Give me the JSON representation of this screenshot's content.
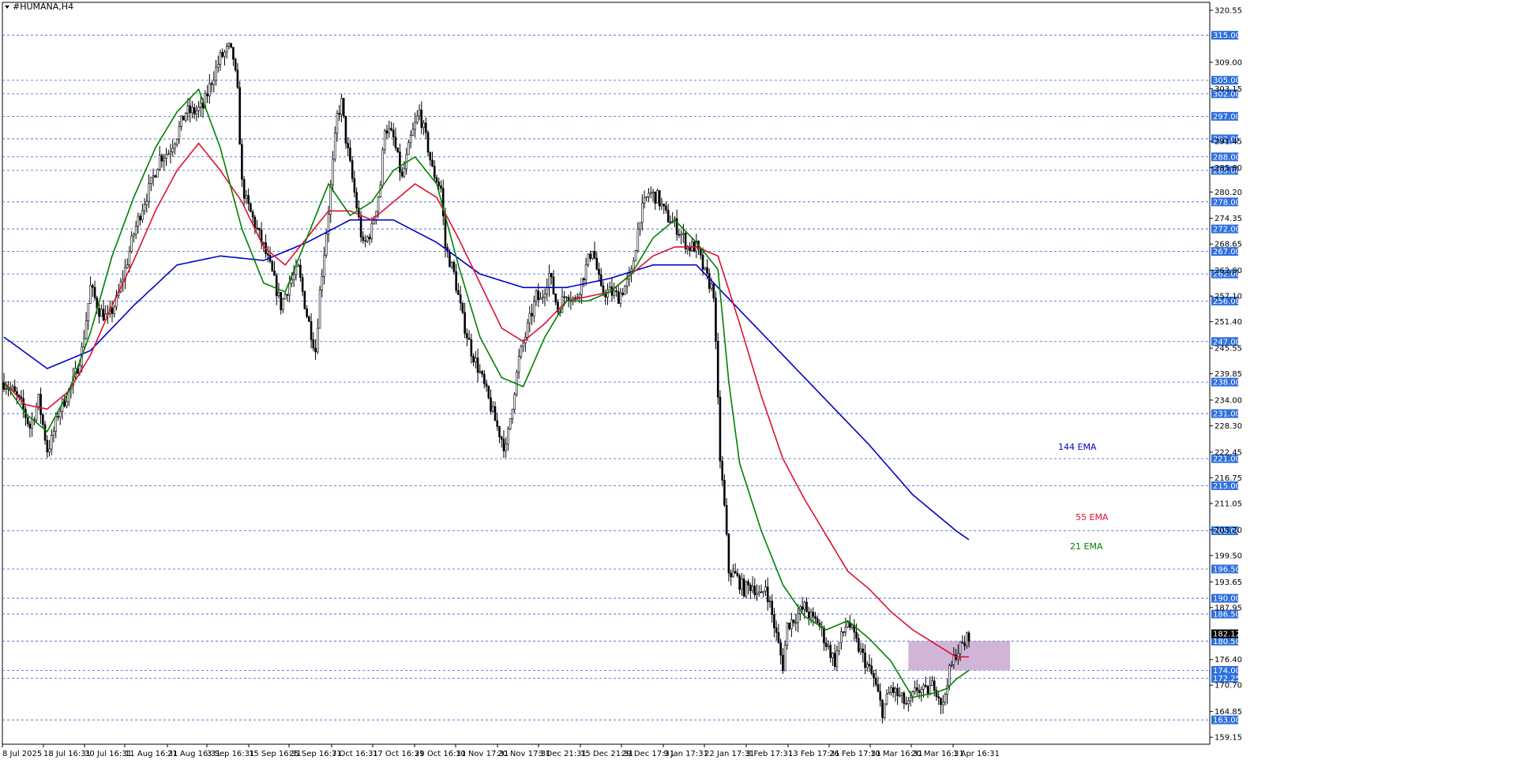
{
  "window": {
    "title": "#HUMANA,H4",
    "menu_icon": "triangle-down-icon"
  },
  "colors": {
    "level_line": "#3a5fcd",
    "level_label_bg": "#2f6fde",
    "ema21": "#008000",
    "ema55": "#e0102f",
    "ema144": "#0000cc",
    "zone_fill": "#c8a8d0",
    "current_price_bg": "#000000",
    "candle": "#000000"
  },
  "chart_data": {
    "type": "candlestick",
    "symbol": "#HUMANA",
    "timeframe": "H4",
    "x_tick_labels": [
      "8 Jul 2025",
      "18 Jul 16:31",
      "30 Jul 16:31",
      "11 Aug 16:31",
      "21 Aug 16:31",
      "3 Sep 16:31",
      "15 Sep 16:31",
      "25 Sep 16:31",
      "7 Oct 16:31",
      "17 Oct 16:31",
      "29 Oct 16:31",
      "10 Nov 17:31",
      "20 Nov 17:31",
      "3 Dec 21:31",
      "15 Dec 21:31",
      "29 Dec 17:31",
      "9 Jan 17:31",
      "22 Jan 17:31",
      "3 Feb 17:31",
      "13 Feb 17:31",
      "26 Feb 17:31",
      "10 Mar 16:31",
      "20 Mar 16:31",
      "1 Apr 16:31"
    ],
    "y_tick_labels": [
      "320.55",
      "309.00",
      "303.15",
      "291.45",
      "285.60",
      "280.20",
      "274.35",
      "268.65",
      "262.80",
      "257.10",
      "251.40",
      "245.55",
      "239.85",
      "234.00",
      "228.30",
      "222.45",
      "216.75",
      "211.05",
      "205.20",
      "199.50",
      "193.65",
      "187.95",
      "176.40",
      "170.70",
      "164.85",
      "159.15"
    ],
    "ylim": [
      157.6,
      322.3
    ],
    "levels": [
      "315.00",
      "305.00",
      "302.00",
      "297.00",
      "292.00",
      "288.00",
      "285.00",
      "278.00",
      "272.00",
      "267.00",
      "262.00",
      "256.00",
      "247.00",
      "238.00",
      "231.00",
      "221.00",
      "215.00",
      "205.00",
      "196.50",
      "190.00",
      "186.50",
      "180.50",
      "174.00",
      "172.25",
      "163.00"
    ],
    "current_price": "182.12",
    "zone": {
      "low": 174.0,
      "high": 180.5
    },
    "close_path": [
      [
        0,
        238
      ],
      [
        4,
        236
      ],
      [
        8,
        233
      ],
      [
        12,
        228
      ],
      [
        16,
        234
      ],
      [
        20,
        223
      ],
      [
        22,
        225
      ],
      [
        25,
        231
      ],
      [
        28,
        234
      ],
      [
        32,
        238
      ],
      [
        36,
        245
      ],
      [
        40,
        259
      ],
      [
        44,
        254
      ],
      [
        48,
        252
      ],
      [
        52,
        256
      ],
      [
        56,
        263
      ],
      [
        60,
        271
      ],
      [
        64,
        277
      ],
      [
        68,
        282
      ],
      [
        72,
        288
      ],
      [
        76,
        289
      ],
      [
        80,
        293
      ],
      [
        84,
        298
      ],
      [
        88,
        298
      ],
      [
        92,
        299
      ],
      [
        96,
        305
      ],
      [
        100,
        310
      ],
      [
        104,
        312
      ],
      [
        106,
        310
      ],
      [
        108,
        302
      ],
      [
        110,
        282
      ],
      [
        112,
        278
      ],
      [
        116,
        273
      ],
      [
        120,
        268
      ],
      [
        124,
        262
      ],
      [
        128,
        255
      ],
      [
        132,
        260
      ],
      [
        136,
        263
      ],
      [
        140,
        253
      ],
      [
        144,
        245
      ],
      [
        146,
        258
      ],
      [
        150,
        276
      ],
      [
        154,
        297
      ],
      [
        156,
        300
      ],
      [
        158,
        292
      ],
      [
        162,
        280
      ],
      [
        166,
        268
      ],
      [
        170,
        272
      ],
      [
        174,
        282
      ],
      [
        176,
        295
      ],
      [
        180,
        292
      ],
      [
        184,
        283
      ],
      [
        188,
        292
      ],
      [
        192,
        298
      ],
      [
        196,
        290
      ],
      [
        198,
        285
      ],
      [
        202,
        281
      ],
      [
        204,
        268
      ],
      [
        208,
        262
      ],
      [
        212,
        252
      ],
      [
        216,
        245
      ],
      [
        220,
        240
      ],
      [
        224,
        234
      ],
      [
        228,
        228
      ],
      [
        232,
        223
      ],
      [
        234,
        230
      ],
      [
        238,
        243
      ],
      [
        242,
        250
      ],
      [
        246,
        257
      ],
      [
        248,
        256
      ],
      [
        252,
        262
      ],
      [
        256,
        254
      ],
      [
        260,
        258
      ],
      [
        264,
        256
      ],
      [
        268,
        262
      ],
      [
        272,
        268
      ],
      [
        276,
        258
      ],
      [
        280,
        258
      ],
      [
        284,
        257
      ],
      [
        288,
        260
      ],
      [
        290,
        262
      ],
      [
        294,
        275
      ],
      [
        298,
        280
      ],
      [
        302,
        279
      ],
      [
        306,
        275
      ],
      [
        310,
        273
      ],
      [
        314,
        270
      ],
      [
        316,
        268
      ],
      [
        320,
        268
      ],
      [
        324,
        262
      ],
      [
        328,
        258
      ],
      [
        331,
        221
      ],
      [
        333,
        210
      ],
      [
        335,
        196
      ],
      [
        338,
        195
      ],
      [
        342,
        192
      ],
      [
        346,
        193
      ],
      [
        350,
        190
      ],
      [
        352,
        193
      ],
      [
        356,
        184
      ],
      [
        360,
        175
      ],
      [
        362,
        184
      ],
      [
        366,
        186
      ],
      [
        370,
        188
      ],
      [
        374,
        185
      ],
      [
        376,
        185
      ],
      [
        380,
        180
      ],
      [
        384,
        176
      ],
      [
        386,
        180
      ],
      [
        390,
        185
      ],
      [
        394,
        180
      ],
      [
        398,
        176
      ],
      [
        402,
        172
      ],
      [
        406,
        165
      ],
      [
        410,
        170
      ],
      [
        414,
        168
      ],
      [
        418,
        166
      ],
      [
        422,
        170
      ],
      [
        426,
        169
      ],
      [
        430,
        171
      ],
      [
        434,
        166
      ],
      [
        436,
        172
      ],
      [
        440,
        178
      ],
      [
        444,
        180
      ],
      [
        446,
        182
      ]
    ],
    "series": [
      {
        "name": "144 EMA",
        "color": "#0000cc",
        "values": [
          [
            0,
            248
          ],
          [
            20,
            241
          ],
          [
            40,
            245
          ],
          [
            60,
            255
          ],
          [
            80,
            264
          ],
          [
            100,
            266
          ],
          [
            120,
            265
          ],
          [
            140,
            269
          ],
          [
            160,
            274
          ],
          [
            180,
            274
          ],
          [
            200,
            269
          ],
          [
            220,
            262
          ],
          [
            240,
            259
          ],
          [
            260,
            259
          ],
          [
            280,
            261
          ],
          [
            300,
            264
          ],
          [
            320,
            264
          ],
          [
            340,
            254
          ],
          [
            360,
            244
          ],
          [
            380,
            234
          ],
          [
            400,
            224
          ],
          [
            420,
            213
          ],
          [
            440,
            205
          ],
          [
            446,
            203
          ]
        ]
      },
      {
        "name": "55 EMA",
        "color": "#e0102f",
        "values": [
          [
            0,
            238
          ],
          [
            10,
            233
          ],
          [
            20,
            232
          ],
          [
            30,
            236
          ],
          [
            40,
            244
          ],
          [
            50,
            255
          ],
          [
            60,
            265
          ],
          [
            70,
            276
          ],
          [
            80,
            285
          ],
          [
            90,
            291
          ],
          [
            100,
            285
          ],
          [
            110,
            278
          ],
          [
            120,
            268
          ],
          [
            130,
            264
          ],
          [
            140,
            270
          ],
          [
            150,
            276
          ],
          [
            160,
            276
          ],
          [
            170,
            274
          ],
          [
            180,
            278
          ],
          [
            190,
            282
          ],
          [
            200,
            279
          ],
          [
            210,
            270
          ],
          [
            220,
            260
          ],
          [
            230,
            250
          ],
          [
            240,
            247
          ],
          [
            250,
            251
          ],
          [
            260,
            256
          ],
          [
            270,
            257
          ],
          [
            280,
            258
          ],
          [
            290,
            262
          ],
          [
            300,
            266
          ],
          [
            310,
            268
          ],
          [
            320,
            268
          ],
          [
            330,
            266
          ],
          [
            340,
            251
          ],
          [
            350,
            235
          ],
          [
            360,
            221
          ],
          [
            370,
            212
          ],
          [
            380,
            204
          ],
          [
            390,
            196
          ],
          [
            400,
            192
          ],
          [
            410,
            187
          ],
          [
            420,
            183
          ],
          [
            430,
            180
          ],
          [
            440,
            177
          ],
          [
            446,
            177
          ]
        ]
      },
      {
        "name": "21 EMA",
        "color": "#008000",
        "values": [
          [
            0,
            238
          ],
          [
            10,
            231
          ],
          [
            20,
            227
          ],
          [
            30,
            236
          ],
          [
            40,
            249
          ],
          [
            50,
            266
          ],
          [
            60,
            279
          ],
          [
            70,
            290
          ],
          [
            80,
            298
          ],
          [
            90,
            303
          ],
          [
            100,
            290
          ],
          [
            110,
            272
          ],
          [
            120,
            260
          ],
          [
            130,
            258
          ],
          [
            140,
            270
          ],
          [
            150,
            282
          ],
          [
            160,
            275
          ],
          [
            170,
            278
          ],
          [
            180,
            285
          ],
          [
            190,
            288
          ],
          [
            200,
            282
          ],
          [
            210,
            264
          ],
          [
            220,
            248
          ],
          [
            230,
            239
          ],
          [
            240,
            237
          ],
          [
            250,
            248
          ],
          [
            260,
            256
          ],
          [
            270,
            256
          ],
          [
            280,
            258
          ],
          [
            290,
            262
          ],
          [
            300,
            270
          ],
          [
            310,
            274
          ],
          [
            320,
            269
          ],
          [
            330,
            263
          ],
          [
            335,
            238
          ],
          [
            340,
            220
          ],
          [
            350,
            205
          ],
          [
            360,
            193
          ],
          [
            370,
            186
          ],
          [
            380,
            183
          ],
          [
            390,
            185
          ],
          [
            400,
            181
          ],
          [
            410,
            176
          ],
          [
            420,
            168
          ],
          [
            430,
            169
          ],
          [
            436,
            170
          ],
          [
            440,
            172
          ],
          [
            446,
            174
          ]
        ]
      }
    ],
    "annotations": [
      {
        "text": "144 EMA",
        "color": "#0000cc"
      },
      {
        "text": "55 EMA",
        "color": "#e0102f"
      },
      {
        "text": "21 EMA",
        "color": "#008000"
      }
    ],
    "grid": false,
    "legend": "right-side text labels"
  }
}
